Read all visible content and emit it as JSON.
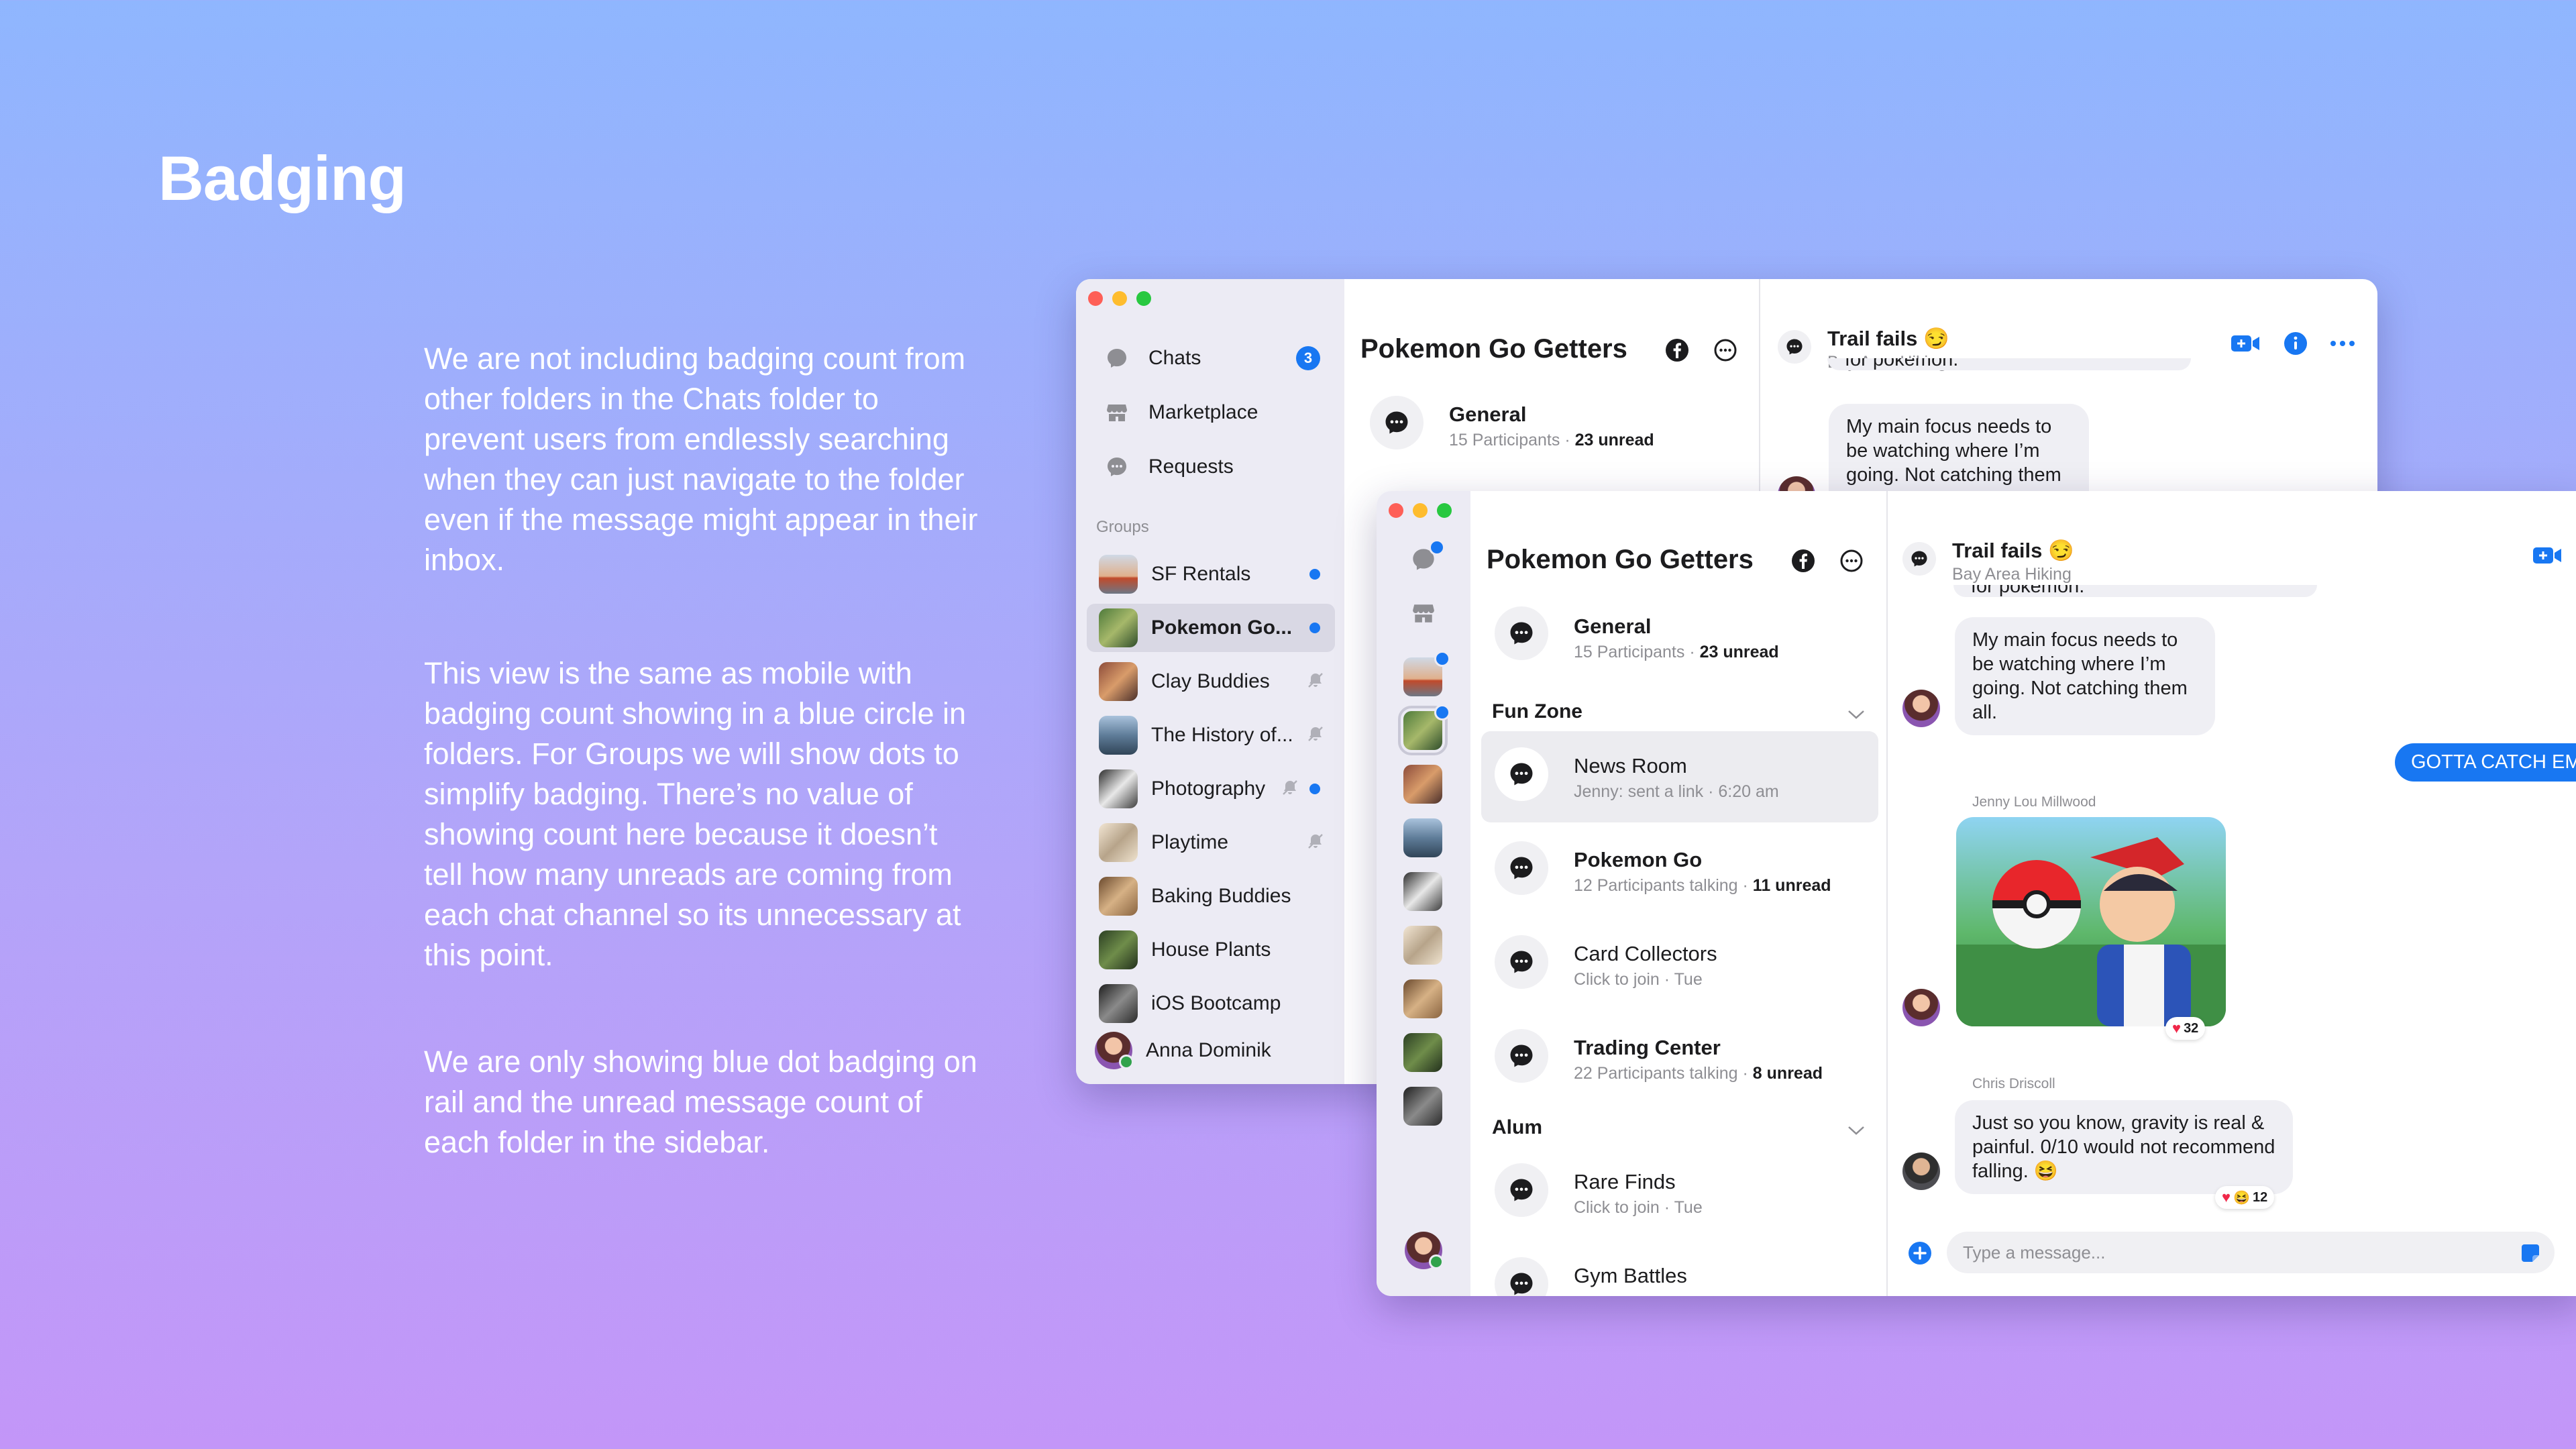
{
  "slide": {
    "title": "Badging",
    "paragraphs": [
      "We are not including badging count from other folders in the Chats folder to prevent users from endlessly searching when they can just navigate to the folder even if the message might appear in their inbox.",
      "This view is the same as mobile with badging count showing in a blue circle in folders. For Groups we will show dots to simplify badging. There’s no value of showing count here because it doesn’t tell how many unreads are coming from each chat channel so its unnecessary at this point.",
      "We are only showing blue dot badging on rail and the unread message count of each folder in the sidebar."
    ]
  },
  "colors": {
    "accent": "#1877f2",
    "sidebar": "#ecebf4",
    "bubble": "#efeff4"
  },
  "back_window": {
    "nav": [
      {
        "label": "Chats",
        "icon": "chat-bubble-icon",
        "badge": "3"
      },
      {
        "label": "Marketplace",
        "icon": "storefront-icon"
      },
      {
        "label": "Requests",
        "icon": "message-request-icon"
      }
    ],
    "groups_label": "Groups",
    "groups": [
      {
        "label": "SF Rentals",
        "indicator": "dot",
        "thumb": "linear-gradient(180deg,#cfd9e6 0%,#e0b08c 55%,#c14a2b 60%,#6d7785 100%)"
      },
      {
        "label": "Pokemon Go...",
        "indicator": "dot",
        "selected": true,
        "thumb": "linear-gradient(135deg,#4e7a3b 0%,#a6b86a 50%,#2f4d2a 100%)"
      },
      {
        "label": "Clay Buddies",
        "indicator": "muted",
        "thumb": "linear-gradient(135deg,#8c4b3a,#d99c6a,#4a2f2a)"
      },
      {
        "label": "The History of...",
        "indicator": "muted",
        "thumb": "linear-gradient(180deg,#a9c2dc 0%,#5f7d99 50%,#314558 100%)"
      },
      {
        "label": "Photography",
        "indicator": "muted-dot",
        "thumb": "linear-gradient(135deg,#2c2c2c,#e8e8e8,#3d3d3d)"
      },
      {
        "label": "Playtime",
        "indicator": "muted",
        "thumb": "linear-gradient(135deg,#f2e6d4,#b7a48a,#efe3cf)"
      },
      {
        "label": "Baking Buddies",
        "indicator": "none",
        "thumb": "linear-gradient(135deg,#6b4a2e,#d6b185,#8a6440)"
      },
      {
        "label": "House Plants",
        "indicator": "none",
        "thumb": "linear-gradient(135deg,#2b3f23,#6f8d4a,#22301c)"
      },
      {
        "label": "iOS Bootcamp",
        "indicator": "none",
        "thumb": "linear-gradient(135deg,#1f1f1f,#8a8a8a,#2b2b2b)"
      }
    ],
    "profile_name": "Anna Dominik",
    "middle": {
      "title": "Pokemon Go Getters",
      "channel_name": "General",
      "channel_sub": "15 Participants · ",
      "channel_unread": "23 unread"
    },
    "chat": {
      "title": "Trail fails",
      "emoji": "😏",
      "subtitle": "Bay Area Hiking",
      "partial_msg": "for pokemon.",
      "message": "My main focus needs to be watching where I’m going. Not catching them all."
    }
  },
  "front_window": {
    "title": "Pokemon Go Getters",
    "general": {
      "name": "General",
      "sub": "15 Participants · ",
      "unread": "23 unread"
    },
    "folders": [
      {
        "name": "Fun Zone",
        "channels": [
          {
            "name": "News Room",
            "sub": "Jenny: sent a link · 6:20 am",
            "unread": "",
            "selected": true
          },
          {
            "name": "Pokemon Go",
            "sub": "12 Participants talking · ",
            "unread": "11 unread"
          },
          {
            "name": "Card Collectors",
            "sub": "Click to join · Tue",
            "unread": ""
          },
          {
            "name": "Trading Center",
            "sub": "22 Participants talking · ",
            "unread": "8 unread"
          }
        ]
      },
      {
        "name": "Alum",
        "channels": [
          {
            "name": "Rare Finds",
            "sub": "Click to join · Tue",
            "unread": ""
          },
          {
            "name": "Gym Battles",
            "sub": "",
            "unread": ""
          }
        ]
      }
    ],
    "chat": {
      "title": "Trail fails",
      "emoji": "😏",
      "subtitle": "Bay Area Hiking",
      "partial_msg": "for pokemon.",
      "message1": "My main focus needs to be watching where I’m going. Not catching them all.",
      "outgoing": "GOTTA CATCH EM",
      "sender1": "Jenny Lou Millwood",
      "reaction1": "32",
      "sender2": "Chris Driscoll",
      "message2": "Just so you know, gravity is real & painful. 0/10 would not recommend falling. 😆",
      "reaction2": "12",
      "composer_placeholder": "Type a message..."
    }
  }
}
